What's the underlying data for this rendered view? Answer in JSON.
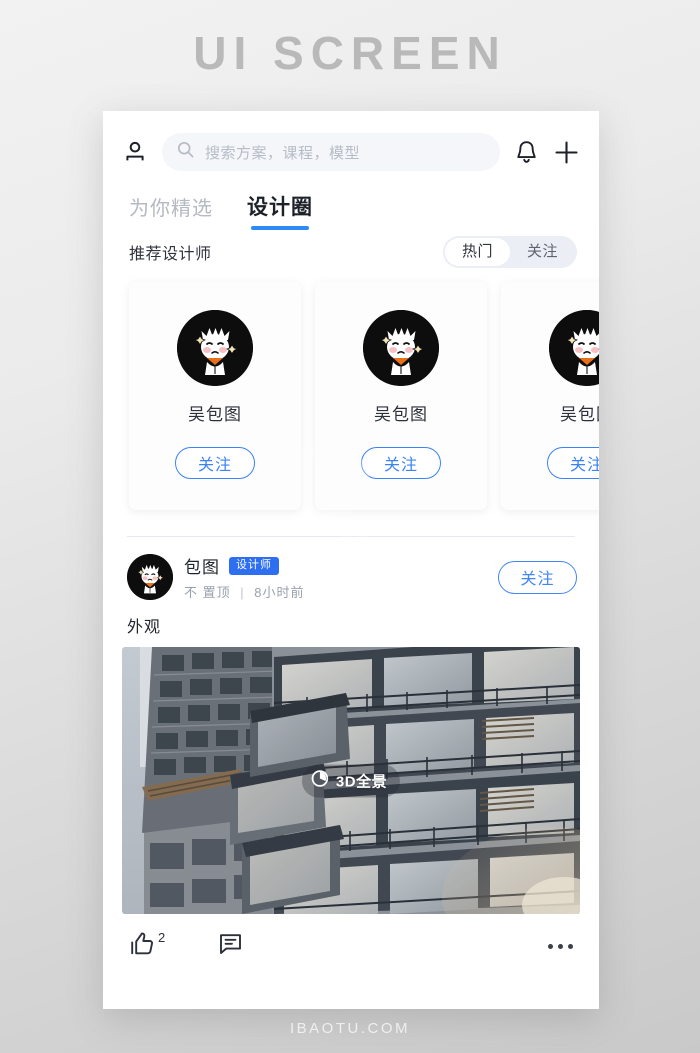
{
  "page": {
    "title": "UI SCREEN",
    "footer": "IBAOTU.COM"
  },
  "colors": {
    "accent_blue": "#3a82f7",
    "badge_blue": "#2e6ff2",
    "tab_underline": "#2e8bf5",
    "muted_text": "#b4b9c2",
    "segment_bg": "#eceef5"
  },
  "topbar": {
    "profile_icon": "person-icon",
    "search": {
      "icon": "search-icon",
      "placeholder": "搜索方案，课程，模型",
      "value": ""
    },
    "bell_icon": "bell-icon",
    "plus_icon": "plus-icon"
  },
  "tabs": [
    {
      "label": "为你精选",
      "active": false
    },
    {
      "label": "设计圈",
      "active": true
    }
  ],
  "section": {
    "title": "推荐设计师",
    "segments": [
      {
        "label": "热门",
        "active": true
      },
      {
        "label": "关注",
        "active": false
      }
    ]
  },
  "designer_cards": [
    {
      "name": "吴包图",
      "follow_label": "关注",
      "avatar": "mascot-avatar"
    },
    {
      "name": "吴包图",
      "follow_label": "关注",
      "avatar": "mascot-avatar"
    },
    {
      "name": "吴包图",
      "follow_label": "关注",
      "avatar": "mascot-avatar"
    }
  ],
  "post": {
    "author": "包图",
    "badge": "设计师",
    "meta_pin": "不 置顶",
    "meta_sep": "|",
    "meta_time": "8小时前",
    "follow_label": "关注",
    "text": "外观",
    "photo": {
      "alt": "modern-apartment-building-facade-with-balconies",
      "panorama_label": "3D全景",
      "panorama_icon": "panorama-3d-icon"
    },
    "actions": {
      "like_icon": "thumbs-up-icon",
      "like_count": "2",
      "comment_icon": "comment-icon",
      "more_icon": "more-dots-icon"
    }
  }
}
